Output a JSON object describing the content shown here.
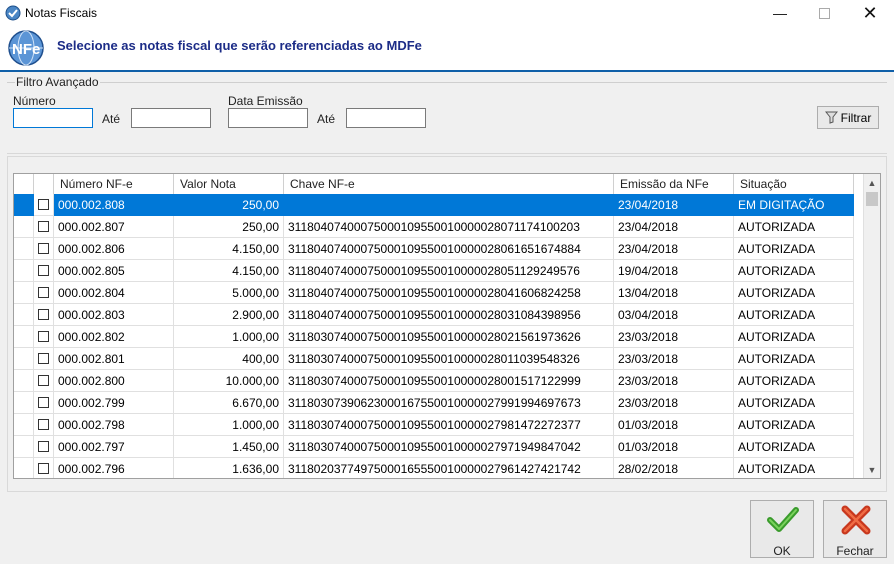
{
  "window": {
    "title": "Notas Fiscais",
    "minimize_icon": "minimize-icon",
    "maximize_icon": "maximize-icon",
    "close_icon": "close-icon"
  },
  "header": {
    "text": "Selecione as notas fiscal que serão referenciadas ao MDFe",
    "logo_icon": "nfe-logo-icon",
    "logo_text": "NFe"
  },
  "filter": {
    "legend": "Filtro Avançado",
    "numero_label": "Número",
    "numero_value": "",
    "ate_label_1": "Até",
    "ate_value_1": "",
    "data_label": "Data Emissão",
    "data_value": "",
    "ate_label_2": "Até",
    "ate_value_2": "",
    "filter_button": "Filtrar",
    "filter_icon": "funnel-icon"
  },
  "grid": {
    "columns": [
      "Número NF-e",
      "Valor Nota",
      "Chave NF-e",
      "Emissão da NFe",
      "Situação"
    ],
    "rows": [
      {
        "numero": "000.002.808",
        "valor": "250,00",
        "chave": "",
        "emissao": "23/04/2018",
        "situacao": "EM DIGITAÇÃO",
        "selected": true
      },
      {
        "numero": "000.002.807",
        "valor": "250,00",
        "chave": "31180407400075000109550010000028071174100203",
        "emissao": "23/04/2018",
        "situacao": "AUTORIZADA",
        "selected": false
      },
      {
        "numero": "000.002.806",
        "valor": "4.150,00",
        "chave": "31180407400075000109550010000028061651674884",
        "emissao": "23/04/2018",
        "situacao": "AUTORIZADA",
        "selected": false
      },
      {
        "numero": "000.002.805",
        "valor": "4.150,00",
        "chave": "31180407400075000109550010000028051129249576",
        "emissao": "19/04/2018",
        "situacao": "AUTORIZADA",
        "selected": false
      },
      {
        "numero": "000.002.804",
        "valor": "5.000,00",
        "chave": "31180407400075000109550010000028041606824258",
        "emissao": "13/04/2018",
        "situacao": "AUTORIZADA",
        "selected": false
      },
      {
        "numero": "000.002.803",
        "valor": "2.900,00",
        "chave": "31180407400075000109550010000028031084398956",
        "emissao": "03/04/2018",
        "situacao": "AUTORIZADA",
        "selected": false
      },
      {
        "numero": "000.002.802",
        "valor": "1.000,00",
        "chave": "31180307400075000109550010000028021561973626",
        "emissao": "23/03/2018",
        "situacao": "AUTORIZADA",
        "selected": false
      },
      {
        "numero": "000.002.801",
        "valor": "400,00",
        "chave": "31180307400075000109550010000028011039548326",
        "emissao": "23/03/2018",
        "situacao": "AUTORIZADA",
        "selected": false
      },
      {
        "numero": "000.002.800",
        "valor": "10.000,00",
        "chave": "31180307400075000109550010000028001517122999",
        "emissao": "23/03/2018",
        "situacao": "AUTORIZADA",
        "selected": false
      },
      {
        "numero": "000.002.799",
        "valor": "6.670,00",
        "chave": "31180307390623000167550010000027991994697673",
        "emissao": "23/03/2018",
        "situacao": "AUTORIZADA",
        "selected": false
      },
      {
        "numero": "000.002.798",
        "valor": "1.000,00",
        "chave": "31180307400075000109550010000027981472272377",
        "emissao": "01/03/2018",
        "situacao": "AUTORIZADA",
        "selected": false
      },
      {
        "numero": "000.002.797",
        "valor": "1.450,00",
        "chave": "31180307400075000109550010000027971949847042",
        "emissao": "01/03/2018",
        "situacao": "AUTORIZADA",
        "selected": false
      },
      {
        "numero": "000.002.796",
        "valor": "1.636,00",
        "chave": "31180203774975000165550010000027961427421742",
        "emissao": "28/02/2018",
        "situacao": "AUTORIZADA",
        "selected": false
      }
    ]
  },
  "buttons": {
    "ok": "OK",
    "ok_icon": "checkmark-icon",
    "fechar": "Fechar",
    "fechar_icon": "x-icon"
  },
  "colors": {
    "header_text": "#1c2c87",
    "selection": "#0078d7",
    "header_line": "#0f5fa8"
  }
}
